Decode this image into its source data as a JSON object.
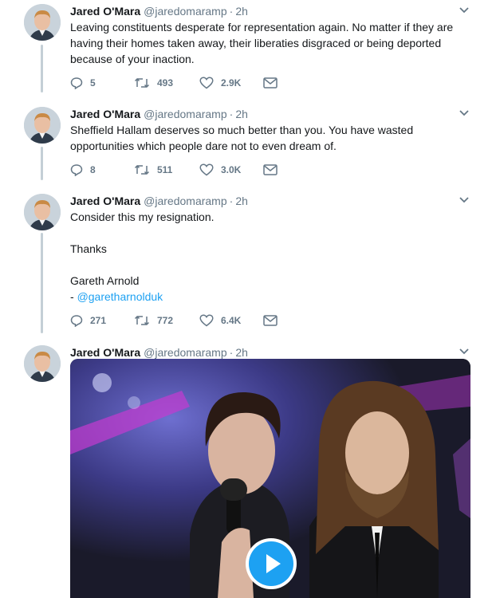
{
  "colors": {
    "accent": "#1da1f2",
    "muted": "#657786",
    "thread": "#c4cfd6"
  },
  "tweets": [
    {
      "name": "Jared O'Mara",
      "handle": "@jaredomaramp",
      "dot": "·",
      "time": "2h",
      "lines": [
        "Leaving constituents desperate for representation again. No matter if they are",
        "having their homes taken away, their liberaties disgraced or being deported",
        "because of your inaction."
      ],
      "replies": "5",
      "retweets": "493",
      "likes": "2.9K"
    },
    {
      "name": "Jared O'Mara",
      "handle": "@jaredomaramp",
      "dot": "·",
      "time": "2h",
      "lines": [
        "Sheffield Hallam deserves so much better than you. You have wasted",
        "opportunities which people dare not to even dream of."
      ],
      "replies": "8",
      "retweets": "511",
      "likes": "3.0K"
    },
    {
      "name": "Jared O'Mara",
      "handle": "@jaredomaramp",
      "dot": "·",
      "time": "2h",
      "line1": "Consider this my resignation.",
      "line2": "Thanks",
      "line3": "Gareth Arnold",
      "line4_prefix": "- ",
      "line4_link": "@garetharnolduk",
      "replies": "271",
      "retweets": "772",
      "likes": "6.4K"
    },
    {
      "name": "Jared O'Mara",
      "handle": "@jaredomaramp",
      "dot": "·",
      "time": "2h"
    }
  ],
  "icons": {
    "reply": "reply-icon",
    "retweet": "retweet-icon",
    "like": "heart-icon",
    "dm": "envelope-icon",
    "caret": "chevron-down-icon",
    "play": "play-icon"
  }
}
